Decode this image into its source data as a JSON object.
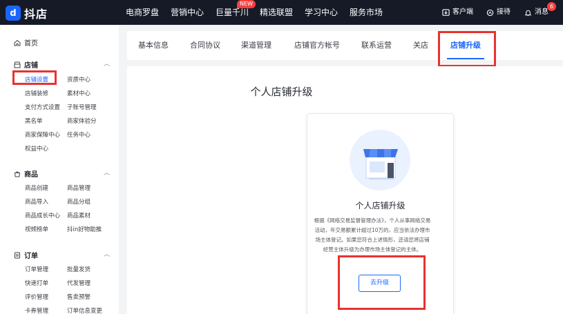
{
  "app": {
    "logo_mark": "d",
    "logo_text": "抖店"
  },
  "topnav": {
    "items": [
      "电商罗盘",
      "营销中心",
      "巨量千川",
      "精选联盟",
      "学习中心",
      "服务市场"
    ],
    "new_badge": "NEW"
  },
  "topright": {
    "client": "客户端",
    "reception": "接待",
    "messages": "消息",
    "message_count": "6"
  },
  "sidebar": {
    "home": "首页",
    "store": {
      "title": "店铺",
      "items": [
        "店铺设置",
        "资质中心",
        "店铺装修",
        "素材中心",
        "支付方式设置",
        "子账号管理",
        "黑名单",
        "商家体验分",
        "商家保障中心",
        "任务中心",
        "权益中心"
      ]
    },
    "goods": {
      "title": "商品",
      "items": [
        "商品创建",
        "商品管理",
        "商品导入",
        "商品分组",
        "商品成长中心",
        "商品素材",
        "视频榜单",
        "抖in好物助推"
      ]
    },
    "orders": {
      "title": "订单",
      "items": [
        "订单管理",
        "批量发货",
        "快速打单",
        "代发管理",
        "评价管理",
        "售卖预警",
        "卡券管理",
        "订单信息变更"
      ]
    }
  },
  "tabs": [
    "基本信息",
    "合同协议",
    "渠道管理",
    "店铺官方帐号",
    "联系运营",
    "关店",
    "店铺升级"
  ],
  "main": {
    "page_title": "个人店铺升级",
    "card_title": "个人店铺升级",
    "card_desc": "根据《网络交易监督管理办法》，个人从事网络交易活动，年交易额累计超过10万的，应当依法办理市场主体登记。如果您符合上述情形，还请您将店铺经营主体升级为办理市场主体登记的主体。",
    "upgrade_button": "去升级"
  },
  "colors": {
    "accent": "#1966ff",
    "topbar": "#151a26",
    "highlight": "#e8322f",
    "badge": "#f53f3f"
  }
}
